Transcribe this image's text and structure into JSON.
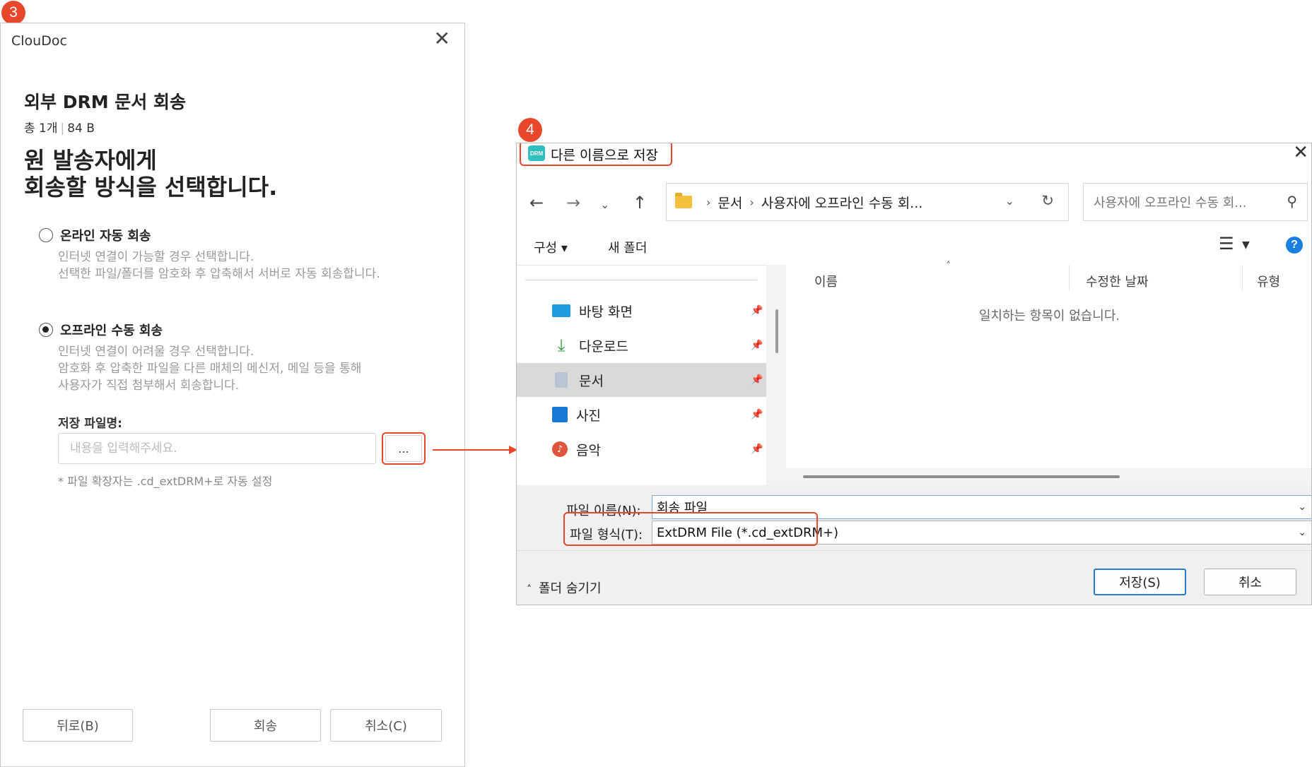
{
  "badges": {
    "step3": "3",
    "step4": "4"
  },
  "clouddoc": {
    "title": "ClouDoc",
    "heading": "외부 DRM 문서 회송",
    "summary_count": "총 1개",
    "summary_size": "84 B",
    "prompt_line1": "원 발송자에게",
    "prompt_line2": "회송할 방식을 선택합니다.",
    "option_online": {
      "label": "온라인 자동 회송",
      "desc1": "인터넷 연결이 가능할 경우 선택합니다.",
      "desc2": "선택한 파일/폴더를 암호화 후 압축해서 서버로 자동 회송합니다.",
      "selected": false
    },
    "option_offline": {
      "label": "오프라인 수동 회송",
      "desc1": "인터넷 연결이 어려울 경우 선택합니다.",
      "desc2": "암호화 후 압축한 파일을 다른 매체의 메신저, 메일 등을 통해",
      "desc3": "사용자가 직접 첨부해서 회송합니다.",
      "selected": true
    },
    "save_name_label": "저장 파일명:",
    "save_name_placeholder": "내용을 입력해주세요.",
    "browse_label": "...",
    "ext_note": "* 파일 확장자는 .cd_extDRM+로 자동 설정",
    "btn_back": "뒤로(B)",
    "btn_return": "회송",
    "btn_cancel": "취소(C)"
  },
  "save_dialog": {
    "title": "다른 이름으로 저장",
    "icon_text": "DRM",
    "breadcrumb": [
      "문서",
      "사용자에 오프라인 수동 회..."
    ],
    "search_placeholder": "사용자에 오프라인 수동 회...",
    "toolbar_organize": "구성 ▾",
    "toolbar_new_folder": "새 폴더",
    "nav_items": [
      {
        "label": "바탕 화면",
        "icon": "desktop-icon"
      },
      {
        "label": "다운로드",
        "icon": "download-icon"
      },
      {
        "label": "문서",
        "icon": "documents-icon",
        "selected": true
      },
      {
        "label": "사진",
        "icon": "pictures-icon"
      },
      {
        "label": "음악",
        "icon": "music-icon"
      }
    ],
    "columns": {
      "name": "이름",
      "date": "수정한 날짜",
      "type": "유형"
    },
    "empty_message": "일치하는 항목이 없습니다.",
    "file_name_label": "파일 이름(N):",
    "file_name_value": "회송 파일",
    "file_type_label": "파일 형식(T):",
    "file_type_value": "ExtDRM File (*.cd_extDRM+)",
    "hide_folders": "폴더 숨기기",
    "btn_save": "저장(S)",
    "btn_cancel": "취소"
  },
  "colors": {
    "highlight": "#e8472b",
    "accent_blue": "#1a7fe0"
  }
}
